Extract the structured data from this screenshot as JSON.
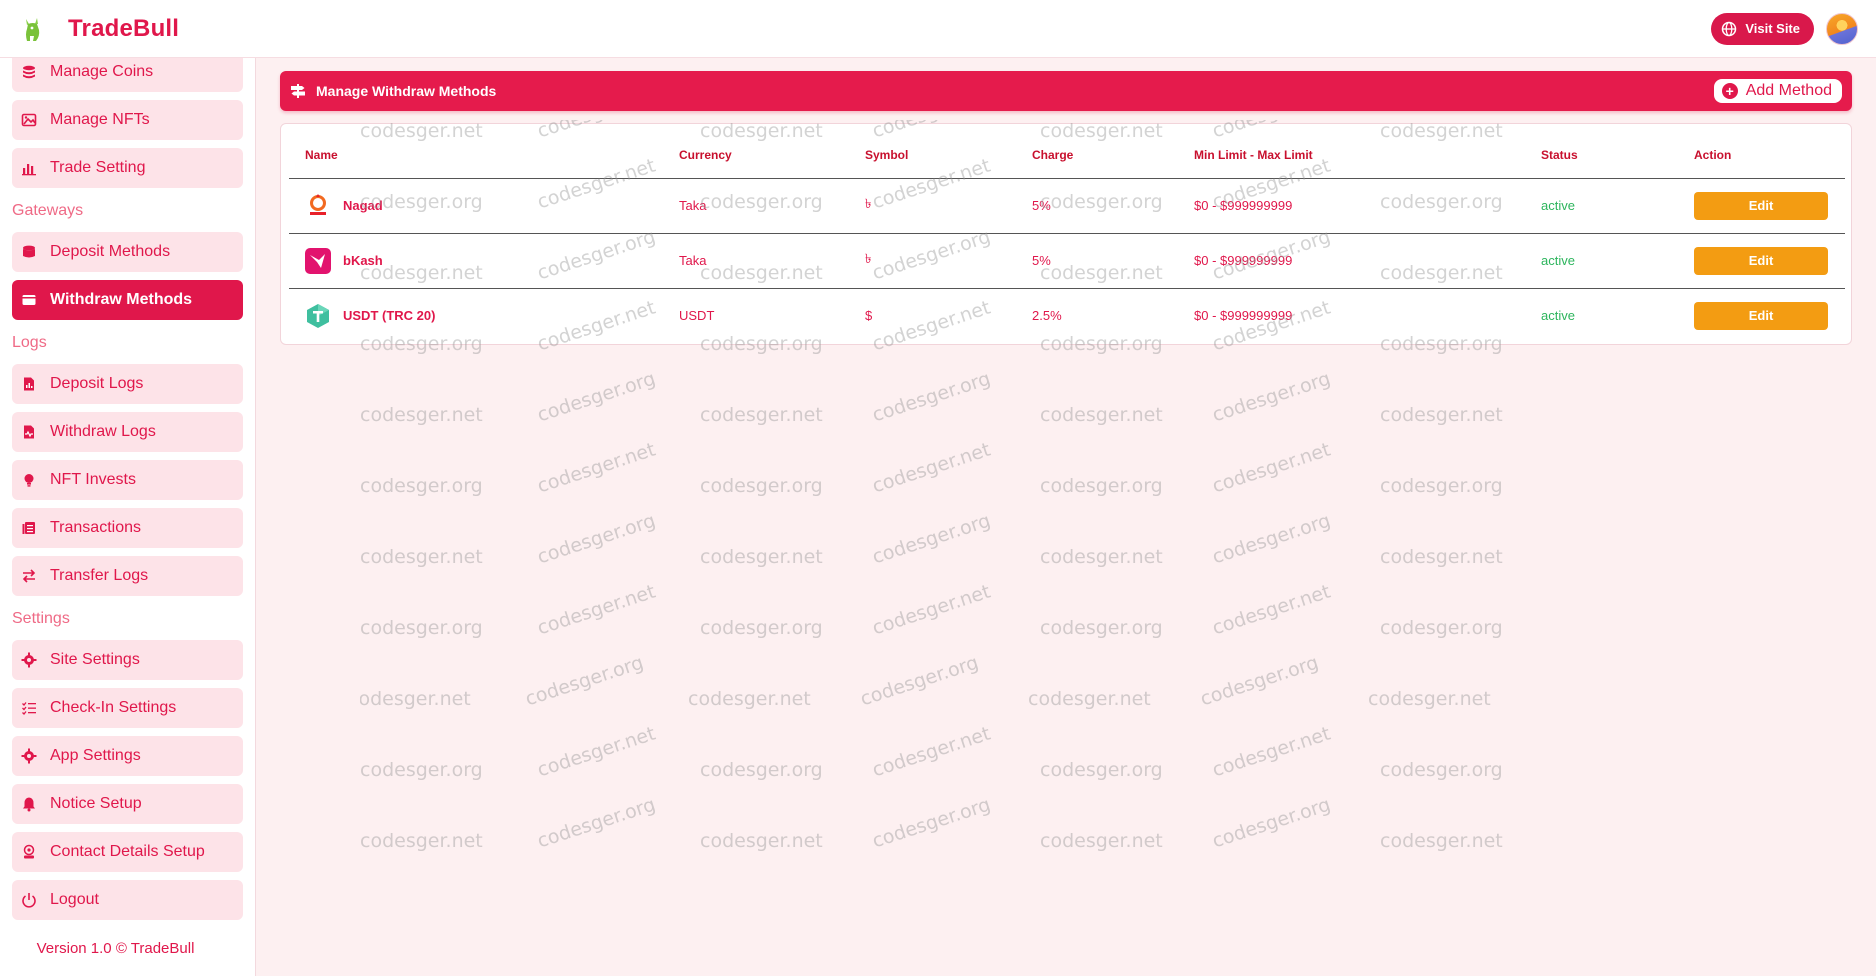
{
  "app": {
    "name": "TradeBull"
  },
  "header": {
    "visit_site": "Visit Site"
  },
  "sidebar": {
    "items_top": [
      {
        "label": "Manage Coins",
        "icon": "coins-icon"
      },
      {
        "label": "Manage NFTs",
        "icon": "image-icon"
      },
      {
        "label": "Trade Setting",
        "icon": "bar-chart-icon"
      }
    ],
    "gateways_heading": "Gateways",
    "gateways": [
      {
        "label": "Deposit Methods",
        "icon": "database-icon"
      },
      {
        "label": "Withdraw Methods",
        "icon": "wallet-icon",
        "active": true
      }
    ],
    "logs_heading": "Logs",
    "logs": [
      {
        "label": "Deposit Logs",
        "icon": "file-chart-icon"
      },
      {
        "label": "Withdraw Logs",
        "icon": "file-pulse-icon"
      },
      {
        "label": "NFT Invests",
        "icon": "lightbulb-icon"
      },
      {
        "label": "Transactions",
        "icon": "ledger-icon"
      },
      {
        "label": "Transfer Logs",
        "icon": "transfer-icon"
      }
    ],
    "settings_heading": "Settings",
    "settings": [
      {
        "label": "Site Settings",
        "icon": "gear-icon"
      },
      {
        "label": "Check-In Settings",
        "icon": "checklist-icon"
      },
      {
        "label": "App Settings",
        "icon": "gear-icon"
      },
      {
        "label": "Notice Setup",
        "icon": "bell-icon"
      },
      {
        "label": "Contact Details Setup",
        "icon": "contact-icon"
      },
      {
        "label": "Logout",
        "icon": "power-icon"
      }
    ],
    "version": "Version 1.0 © TradeBull"
  },
  "page": {
    "title": "Manage Withdraw Methods",
    "add_button": "Add Method",
    "columns": [
      "Name",
      "Currency",
      "Symbol",
      "Charge",
      "Min Limit - Max Limit",
      "Status",
      "Action"
    ],
    "rows": [
      {
        "name": "Nagad",
        "currency": "Taka",
        "symbol": "৳",
        "charge": "5%",
        "limits": "$0 - $999999999",
        "status": "active",
        "action": "Edit",
        "logo": "nagad-logo"
      },
      {
        "name": "bKash",
        "currency": "Taka",
        "symbol": "৳",
        "charge": "5%",
        "limits": "$0 - $999999999",
        "status": "active",
        "action": "Edit",
        "logo": "bkash-logo"
      },
      {
        "name": "USDT (TRC 20)",
        "currency": "USDT",
        "symbol": "$",
        "charge": "2.5%",
        "limits": "$0 - $999999999",
        "status": "active",
        "action": "Edit",
        "logo": "tether-logo"
      }
    ]
  },
  "watermark": {
    "a": "codesger.net",
    "b": "codesger.org"
  },
  "colors": {
    "accent": "#e0174b",
    "edit": "#f39c12",
    "status_active": "#2db55d",
    "background": "#fdf0f1"
  }
}
